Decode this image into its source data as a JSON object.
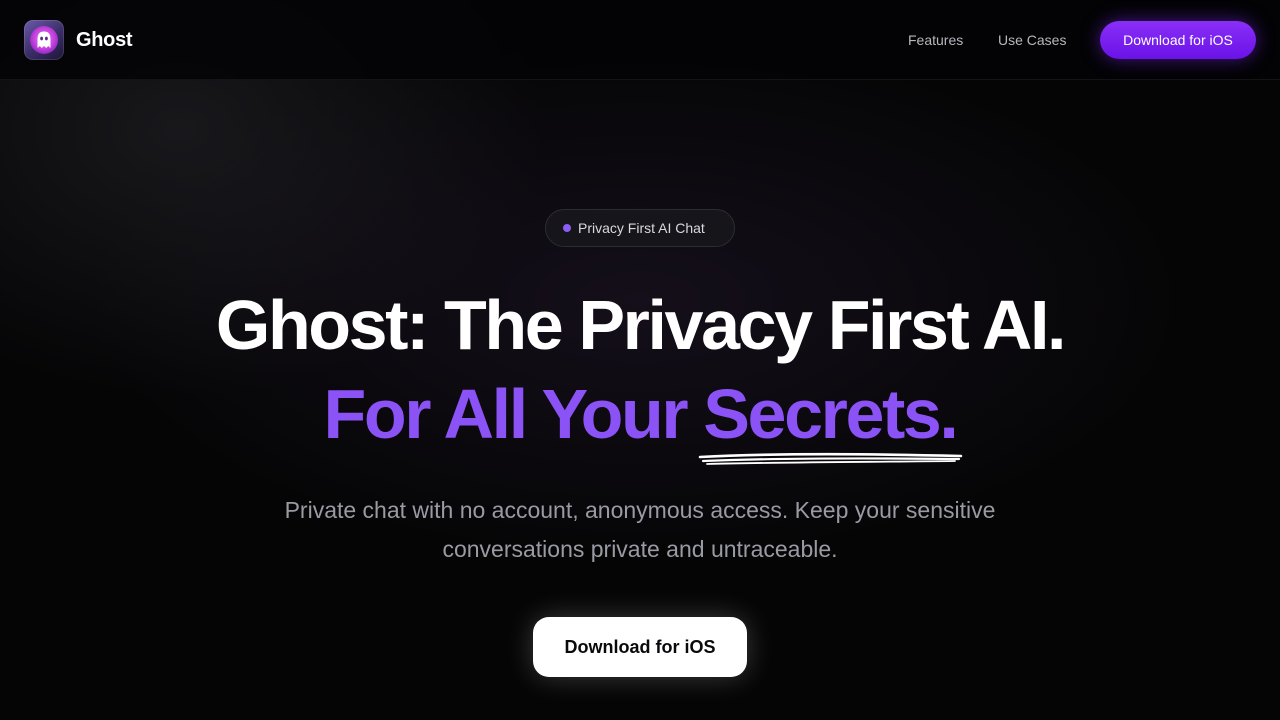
{
  "header": {
    "brand_name": "Ghost",
    "logo_icon": "ghost-icon",
    "nav": [
      {
        "label": "Features"
      },
      {
        "label": "Use Cases"
      }
    ],
    "cta_label": "Download for iOS"
  },
  "hero": {
    "badge_label": "Privacy First AI Chat",
    "headline_line1": "Ghost: The Privacy First AI.",
    "headline_line2_part1": "For All Your ",
    "headline_line2_highlight": "Secrets.",
    "subtitle": "Private chat with no account, anonymous access. Keep your sensitive conversations private and untraceable.",
    "cta_label": "Download for iOS"
  },
  "colors": {
    "background": "#000000",
    "accent_purple": "#8b52f5",
    "cta_purple": "#7a1ff0",
    "text_muted": "#9a9aa4"
  }
}
